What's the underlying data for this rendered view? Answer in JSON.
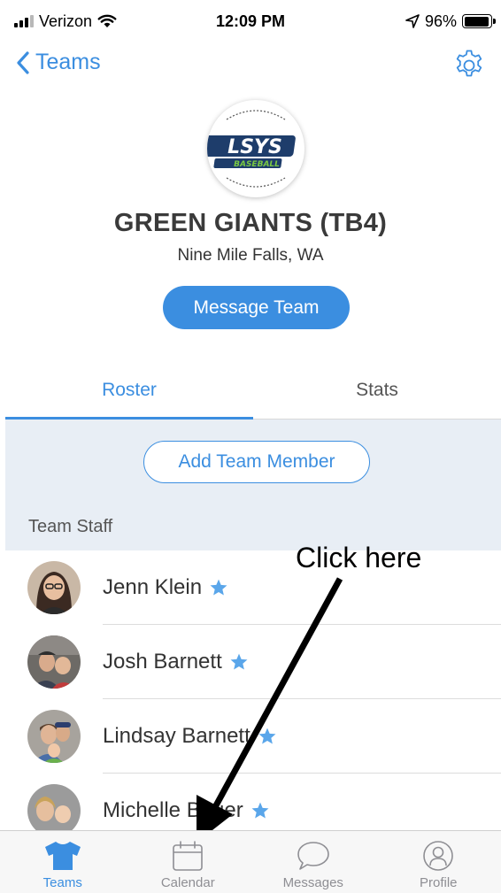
{
  "status_bar": {
    "carrier": "Verizon",
    "time": "12:09 PM",
    "battery": "96%",
    "battery_level": 0.96
  },
  "nav": {
    "back_label": "Teams"
  },
  "team": {
    "name": "GREEN GIANTS (TB4)",
    "location": "Nine Mile Falls, WA",
    "logo_text": "LSYS",
    "logo_subtext": "BASEBALL"
  },
  "actions": {
    "message_team": "Message Team",
    "add_member": "Add Team Member"
  },
  "tabs": [
    {
      "label": "Roster"
    },
    {
      "label": "Stats"
    }
  ],
  "roster": {
    "section_title": "Team Staff",
    "members": [
      {
        "name": "Jenn Klein"
      },
      {
        "name": "Josh Barnett"
      },
      {
        "name": "Lindsay Barnett"
      },
      {
        "name": "Michelle Bauer"
      }
    ]
  },
  "annotation": {
    "text": "Click here"
  },
  "tab_bar": [
    {
      "label": "Teams"
    },
    {
      "label": "Calendar"
    },
    {
      "label": "Messages"
    },
    {
      "label": "Profile"
    }
  ],
  "colors": {
    "accent": "#3b8ee0",
    "star": "#5aa6ea",
    "panel": "#e8eef5"
  }
}
